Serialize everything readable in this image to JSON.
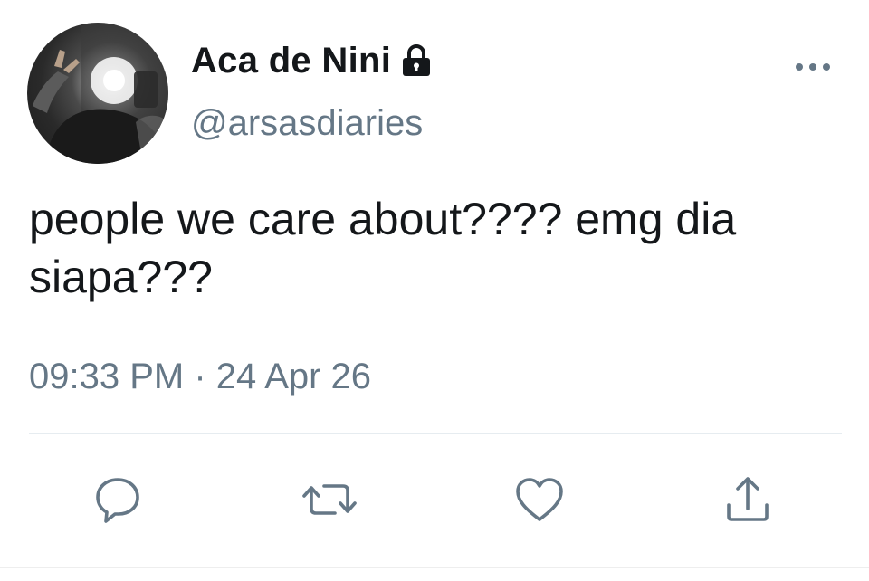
{
  "user": {
    "display_name": "Aca de Nini",
    "handle": "@arsasdiaries",
    "protected_icon": "lock-icon"
  },
  "tweet": {
    "text": "people we care about???? emg dia siapa???",
    "time": "09:33 PM",
    "separator": "·",
    "date": "24 Apr 26"
  },
  "actions": {
    "reply_icon": "reply-icon",
    "retweet_icon": "retweet-icon",
    "like_icon": "heart-icon",
    "share_icon": "share-icon"
  },
  "colors": {
    "text": "#14171a",
    "secondary": "#657786",
    "icon": "#657786",
    "divider": "#e6ecf0"
  }
}
